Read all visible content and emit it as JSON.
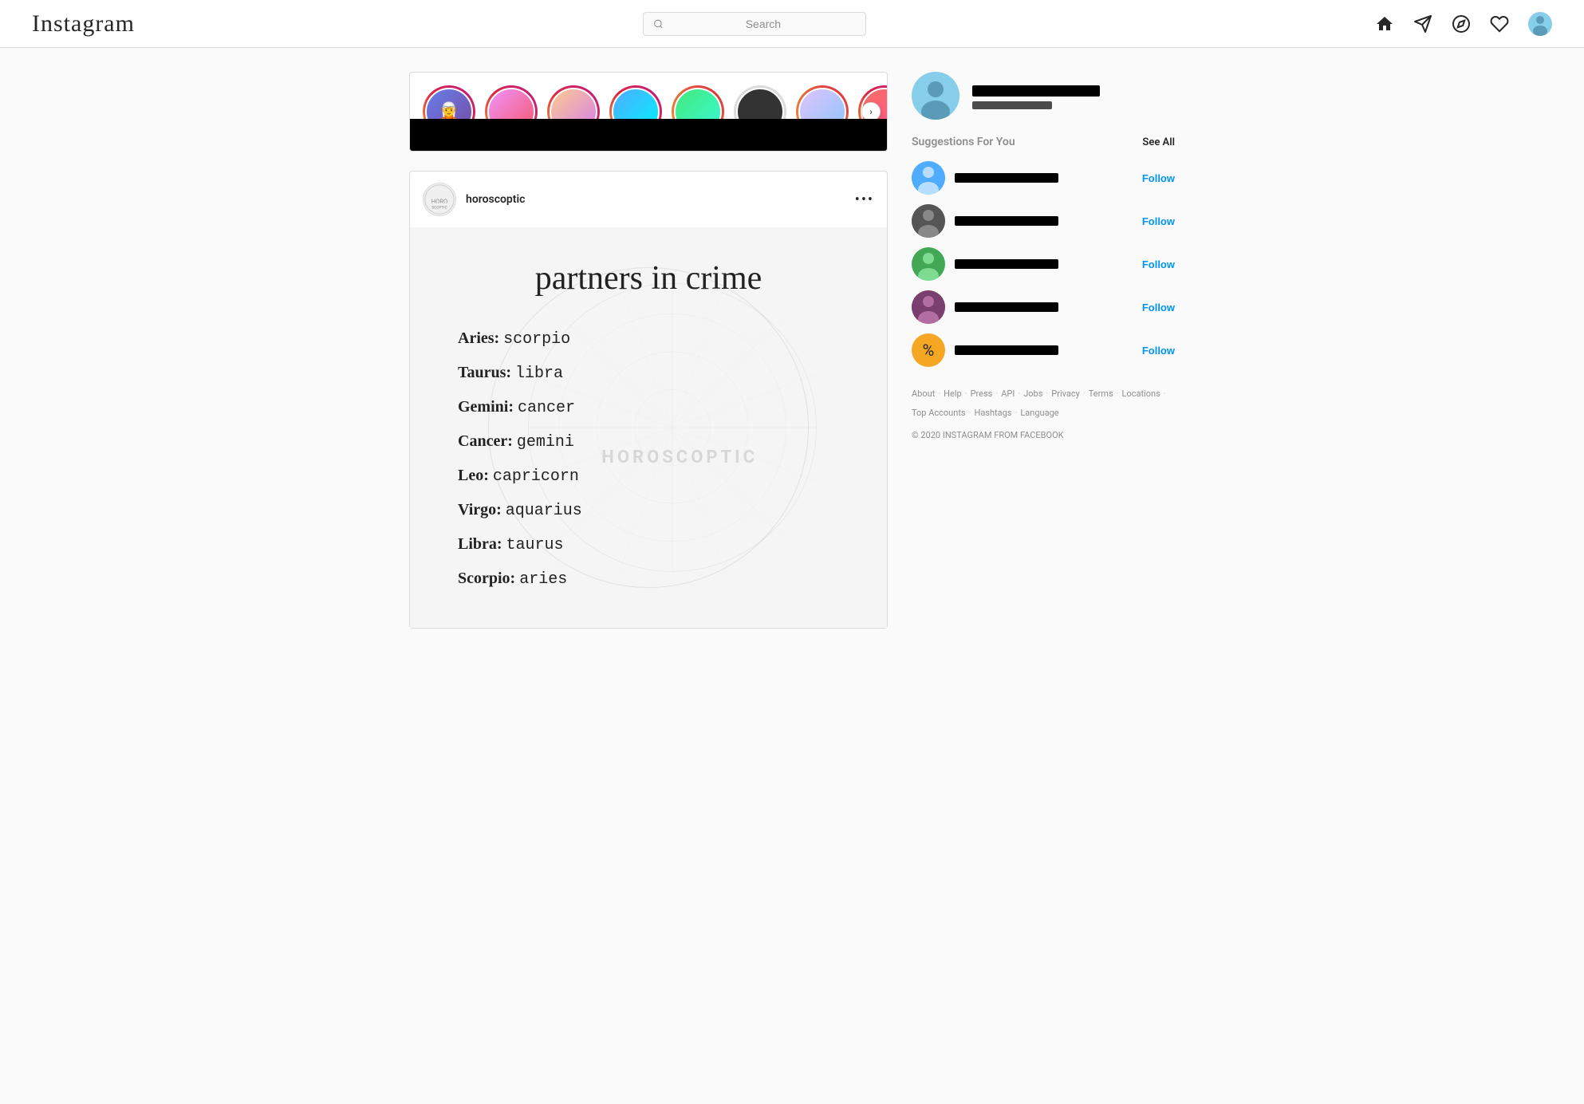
{
  "header": {
    "logo": "Instagram",
    "search_placeholder": "Search",
    "icons": {
      "home": "⌂",
      "send": "▷",
      "explore": "◎",
      "heart": "♡"
    }
  },
  "stories": {
    "next_button": "›",
    "items": [
      {
        "id": 1,
        "label": "",
        "ring": "gradient"
      },
      {
        "id": 2,
        "label": "",
        "ring": "gradient"
      },
      {
        "id": 3,
        "label": "",
        "ring": "gradient"
      },
      {
        "id": 4,
        "label": "",
        "ring": "gradient"
      },
      {
        "id": 5,
        "label": "",
        "ring": "gradient"
      },
      {
        "id": 6,
        "label": "",
        "ring": "inactive"
      },
      {
        "id": 7,
        "label": "",
        "ring": "orange"
      },
      {
        "id": 8,
        "label": "",
        "ring": "gradient"
      }
    ]
  },
  "post": {
    "username": "horoscoptic",
    "more_icon": "•••",
    "title": "partners in crime",
    "zodiac_pairs": [
      {
        "sign": "Aries:",
        "match": "scorpio"
      },
      {
        "sign": "Taurus:",
        "match": "libra"
      },
      {
        "sign": "Gemini:",
        "match": "cancer"
      },
      {
        "sign": "Cancer:",
        "match": "gemini"
      },
      {
        "sign": "Leo:",
        "match": "capricorn"
      },
      {
        "sign": "Virgo:",
        "match": "aquarius"
      },
      {
        "sign": "Libra:",
        "match": "taurus"
      },
      {
        "sign": "Scorpio:",
        "match": "aries"
      }
    ],
    "watermark": "HOROSCOPTIC"
  },
  "sidebar": {
    "profile_redacted": true,
    "suggestions_title": "Suggestions For You",
    "see_all": "See All",
    "suggestions": [
      {
        "id": 1,
        "follow_label": "Follow"
      },
      {
        "id": 2,
        "follow_label": "Follow"
      },
      {
        "id": 3,
        "follow_label": "Follow"
      },
      {
        "id": 4,
        "follow_label": "Follow"
      },
      {
        "id": 5,
        "follow_label": "Follow"
      }
    ],
    "footer": {
      "links": [
        "About",
        "Help",
        "Press",
        "API",
        "Jobs",
        "Privacy",
        "Terms",
        "Locations",
        "Top Accounts",
        "Hashtags",
        "Language"
      ],
      "copyright": "© 2020 INSTAGRAM FROM FACEBOOK"
    }
  }
}
